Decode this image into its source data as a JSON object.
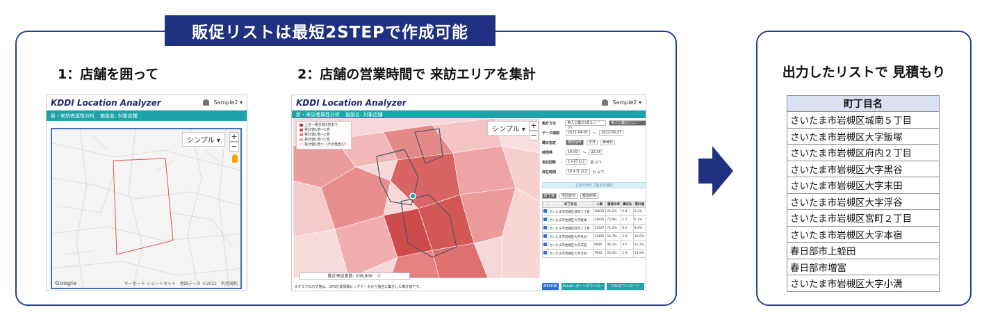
{
  "banner": "販促リストは最短2STEPで作成可能",
  "step1": {
    "title": "1：店舗を囲って"
  },
  "step2": {
    "title": "2：店舗の営業時間で 来訪エリアを集計"
  },
  "output": {
    "title": "出力したリストで 見積もり",
    "table_header": "町丁目名",
    "rows": [
      "さいたま市岩槻区城南５丁目",
      "さいたま市岩槻区大字飯塚",
      "さいたま市岩槻区府内２丁目",
      "さいたま市岩槻区大字黒谷",
      "さいたま市岩槻区大字末田",
      "さいたま市岩槻区大字浮谷",
      "さいたま市岩槻区宮町２丁目",
      "さいたま市岩槻区大字本宿",
      "春日部市上蛭田",
      "春日部市増富",
      "さいたま市岩槻区大字小溝"
    ]
  },
  "app": {
    "logo_brand": "KDDI",
    "logo_product": "Location Analyzer",
    "user": "Sample2 ▾",
    "nav1": "新・来訪者属性分析",
    "nav2": "施設名: 対象店舗",
    "nav2b": "施設名: 対象店舗",
    "map_style": "シンプル ▾",
    "zoom_in": "+",
    "zoom_out": "−",
    "map_footer": "キーボード ショートカット　地図データ ©2022　利用規約",
    "google": "Google"
  },
  "app2": {
    "legend": [
      "上位～累計値1倍まで",
      "累計値1倍～1倍",
      "累計値1倍～1倍",
      "累計値1倍～1倍",
      "累計値1倍～（その他含む）"
    ],
    "legend_colors": [
      "#b72a2a",
      "#d94a4a",
      "#e67a7a",
      "#f2aaaa",
      "#fbe1e1"
    ],
    "count_label": "推計来訪者数: 508,806　人",
    "form": {
      "agg_label": "集計方法",
      "agg_opt1": "来人口集計(非ユニーク)",
      "agg_opt2": "来人口集計(ユニーク)",
      "period_label": "データ期間",
      "date_from": "2022-04-01",
      "date_to": "2022-06-27",
      "day_label": "曜日指定",
      "day_opt1": "期間全体",
      "day_opt2": "平日",
      "day_opt3": "休休日",
      "time_label": "時間帯",
      "time_from": "10:00",
      "time_to": "22:00",
      "stay_label": "来訪回数",
      "stay_val": "1 ▾ 回 以上",
      "stay_val2": "回 以下",
      "dwell_label": "滞在時間",
      "dwell_val": "10 ▾ 分 以上",
      "dwell_val2": "分 以下",
      "agg_button": "上記の条件で集計を実行",
      "tabs": [
        "町丁目",
        "市区町村",
        "都道府県"
      ],
      "col_name": "町丁目名",
      "col_pop": "人数",
      "col_rate": "獲得比率",
      "col_share": "構成比",
      "col_cum": "累計値",
      "table_rows": [
        {
          "name": "さいたま市岩槻区城南５丁目",
          "pop": "16612",
          "rate": "74.1%",
          "share": "0.4",
          "cum": "3.2%"
        },
        {
          "name": "さいたま市岩槻区大字飯塚",
          "pop": "14916",
          "rate": "73.9%",
          "share": "1.2",
          "cum": "6.1%"
        },
        {
          "name": "さいたま市岩槻区府内２丁目",
          "pop": "11527",
          "rate": "74.2%",
          "share": "0.2",
          "cum": "8.4%"
        },
        {
          "name": "さいたま市岩槻区大字黒谷",
          "pop": "11465",
          "rate": "50.7%",
          "share": "2.9",
          "cum": "10.6%"
        },
        {
          "name": "さいたま市岩槻区大字末田",
          "pop": "9846",
          "rate": "46.2%",
          "share": "4.5",
          "cum": "12.3%"
        },
        {
          "name": "さいたま市岩槻区大字浮谷",
          "pop": "7935",
          "rate": "50.0%",
          "share": "1.9",
          "cum": "13.9%"
        }
      ],
      "note": "※地図表示において、精度が低い場合があります",
      "btn_mesh": "MESH表示",
      "btn_excel": "Excelレポートダウンロード",
      "btn_csv": "CSVダウンロード",
      "bottom_note": "※グラフの示す値は、GPS位置情報ビッグデータから独自に集計した推計値です。"
    }
  },
  "colors": {
    "navy": "#1f3180",
    "teal": "#1fa3aa",
    "border": "#2a3f8f",
    "header_fill": "#d9e1f2"
  }
}
